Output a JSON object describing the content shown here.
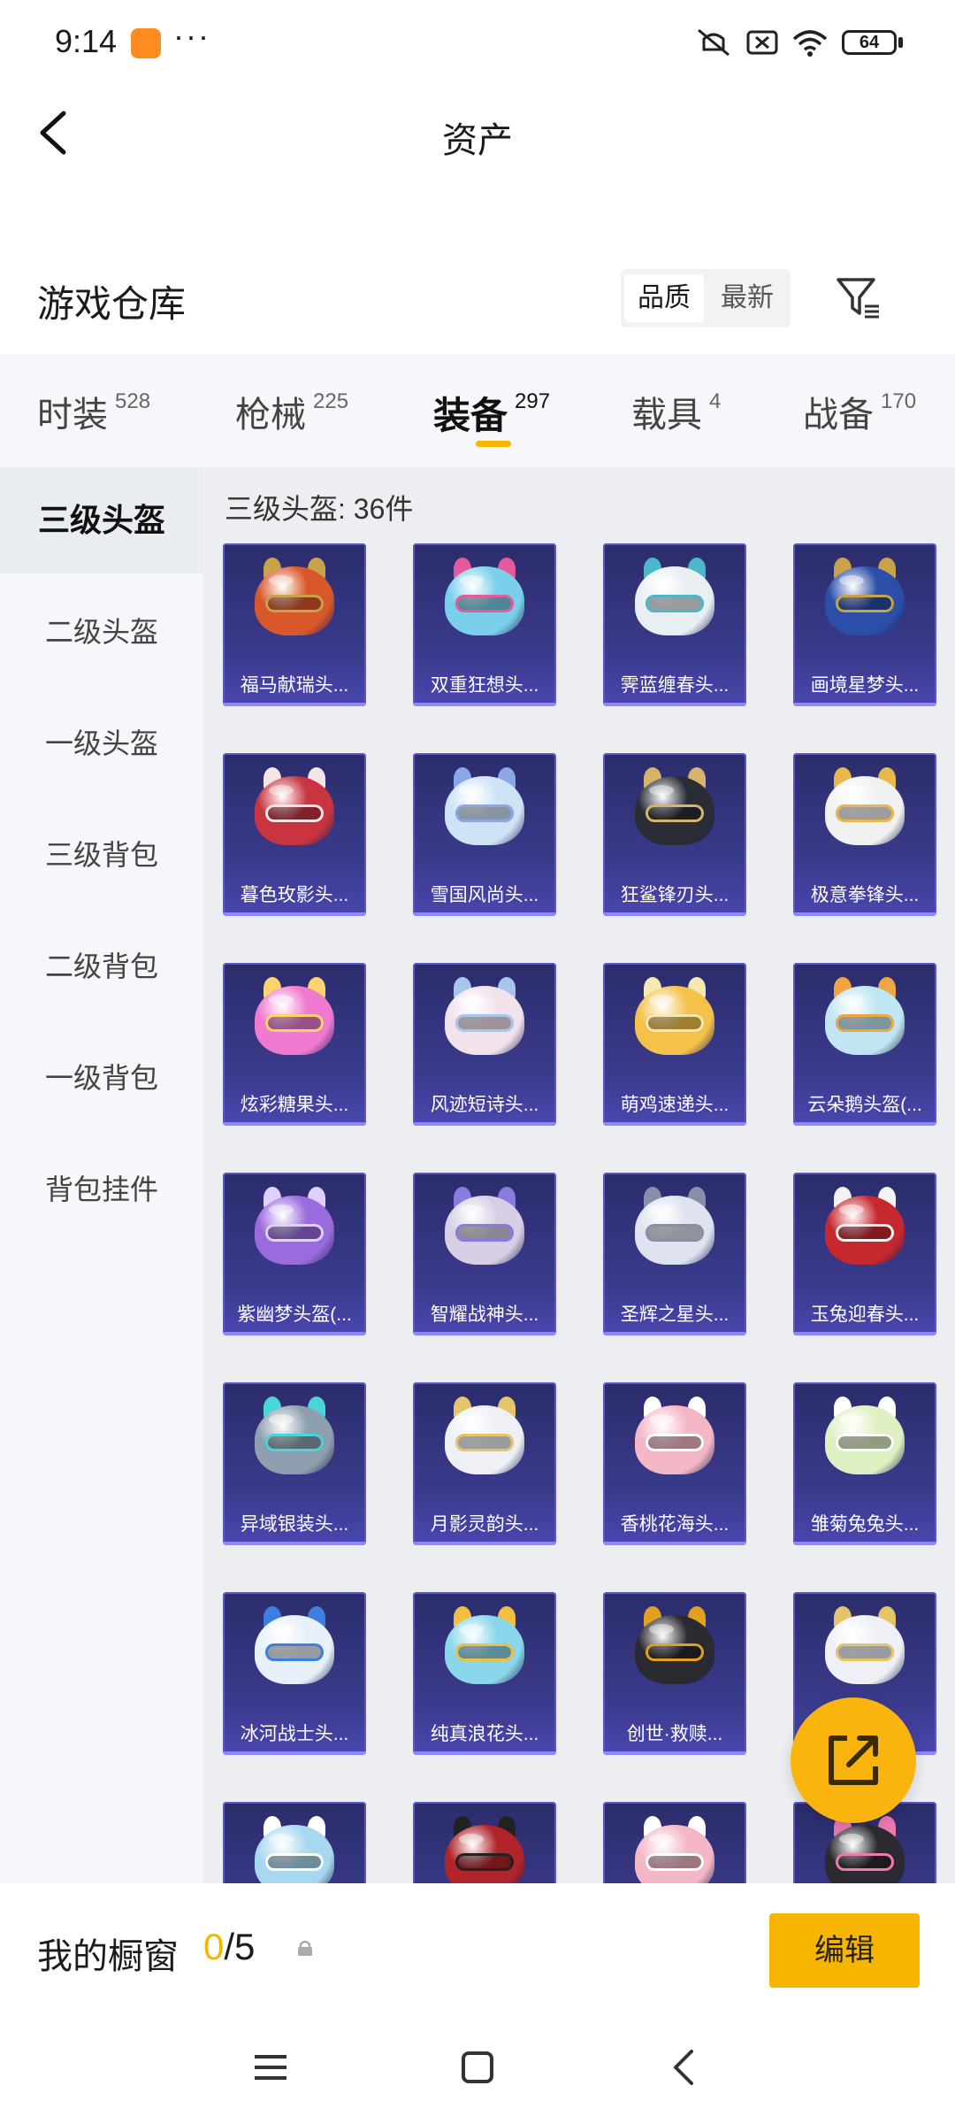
{
  "status_bar": {
    "time": "9:14",
    "battery": "64"
  },
  "header": {
    "title": "资产"
  },
  "warehouse": {
    "title": "游戏仓库",
    "sort": [
      "品质",
      "最新"
    ],
    "sort_active": 0
  },
  "categories": [
    {
      "label": "时装",
      "count": "528"
    },
    {
      "label": "枪械",
      "count": "225"
    },
    {
      "label": "装备",
      "count": "297"
    },
    {
      "label": "载具",
      "count": "4"
    },
    {
      "label": "战备",
      "count": "170"
    }
  ],
  "active_category": 2,
  "sidebar": [
    {
      "label": "三级头盔"
    },
    {
      "label": "二级头盔"
    },
    {
      "label": "一级头盔"
    },
    {
      "label": "三级背包"
    },
    {
      "label": "二级背包"
    },
    {
      "label": "一级背包"
    },
    {
      "label": "背包挂件"
    }
  ],
  "active_sidebar": 0,
  "list_title": "三级头盔: 36件",
  "items": [
    {
      "name": "福马献瑞头...",
      "color": "#d9582b",
      "accent": "#c9a24a"
    },
    {
      "name": "双重狂想头...",
      "color": "#7ad0ea",
      "accent": "#e55a9a"
    },
    {
      "name": "霁蓝缠春头...",
      "color": "#e9eef3",
      "accent": "#4bb8c9"
    },
    {
      "name": "画境星梦头...",
      "color": "#2b4ea8",
      "accent": "#c9a24a"
    },
    {
      "name": "暮色玫影头...",
      "color": "#c8343f",
      "accent": "#f2e6e6"
    },
    {
      "name": "雪国风尚头...",
      "color": "#cfe3f7",
      "accent": "#8aa7e8"
    },
    {
      "name": "狂鲨锋刃头...",
      "color": "#2a2d36",
      "accent": "#d6b46a"
    },
    {
      "name": "极意拳锋头...",
      "color": "#f1f1f1",
      "accent": "#e8b84a"
    },
    {
      "name": "炫彩糖果头...",
      "color": "#f07ad0",
      "accent": "#ffd36b"
    },
    {
      "name": "风迹短诗头...",
      "color": "#f2e2ec",
      "accent": "#a7c7ea"
    },
    {
      "name": "萌鸡速递头...",
      "color": "#f4c24a",
      "accent": "#f7e7b0"
    },
    {
      "name": "云朵鹅头盔(...",
      "color": "#bfe6f2",
      "accent": "#f0a640"
    },
    {
      "name": "紫幽梦头盔(...",
      "color": "#9a6bdc",
      "accent": "#e0d0ff"
    },
    {
      "name": "智耀战神头...",
      "color": "#d8cfe6",
      "accent": "#8a7be0"
    },
    {
      "name": "圣辉之星头...",
      "color": "#dfe3f0",
      "accent": "#8a8fa8"
    },
    {
      "name": "玉兔迎春头...",
      "color": "#c6282f",
      "accent": "#f3f3f3"
    },
    {
      "name": "异域银装头...",
      "color": "#8ea0b0",
      "accent": "#4ad6d6"
    },
    {
      "name": "月影灵韵头...",
      "color": "#eef0f6",
      "accent": "#e5c56a"
    },
    {
      "name": "香桃花海头...",
      "color": "#f4b7c6",
      "accent": "#ffffff"
    },
    {
      "name": "雏菊兔兔头...",
      "color": "#dff0c2",
      "accent": "#ffffff"
    },
    {
      "name": "冰河战士头...",
      "color": "#e8f0fa",
      "accent": "#3d7fe0"
    },
    {
      "name": "纯真浪花头...",
      "color": "#8ad6ea",
      "accent": "#f0c040"
    },
    {
      "name": "创世·救赎...",
      "color": "#2a2a30",
      "accent": "#e0a020"
    },
    {
      "name": "",
      "color": "#eef0f6",
      "accent": "#e5c56a"
    },
    {
      "name": "",
      "color": "#a8d8f0",
      "accent": "#ffffff"
    },
    {
      "name": "",
      "color": "#b0242a",
      "accent": "#222222"
    },
    {
      "name": "",
      "color": "#f4b7c6",
      "accent": "#ffffff"
    },
    {
      "name": "",
      "color": "#2a2a30",
      "accent": "#f07ab0"
    }
  ],
  "showcase": {
    "label": "我的橱窗",
    "current": "0",
    "total": "/5",
    "edit": "编辑"
  },
  "colors": {
    "accent": "#f7b500",
    "card_bg": "#3b3b8e"
  }
}
